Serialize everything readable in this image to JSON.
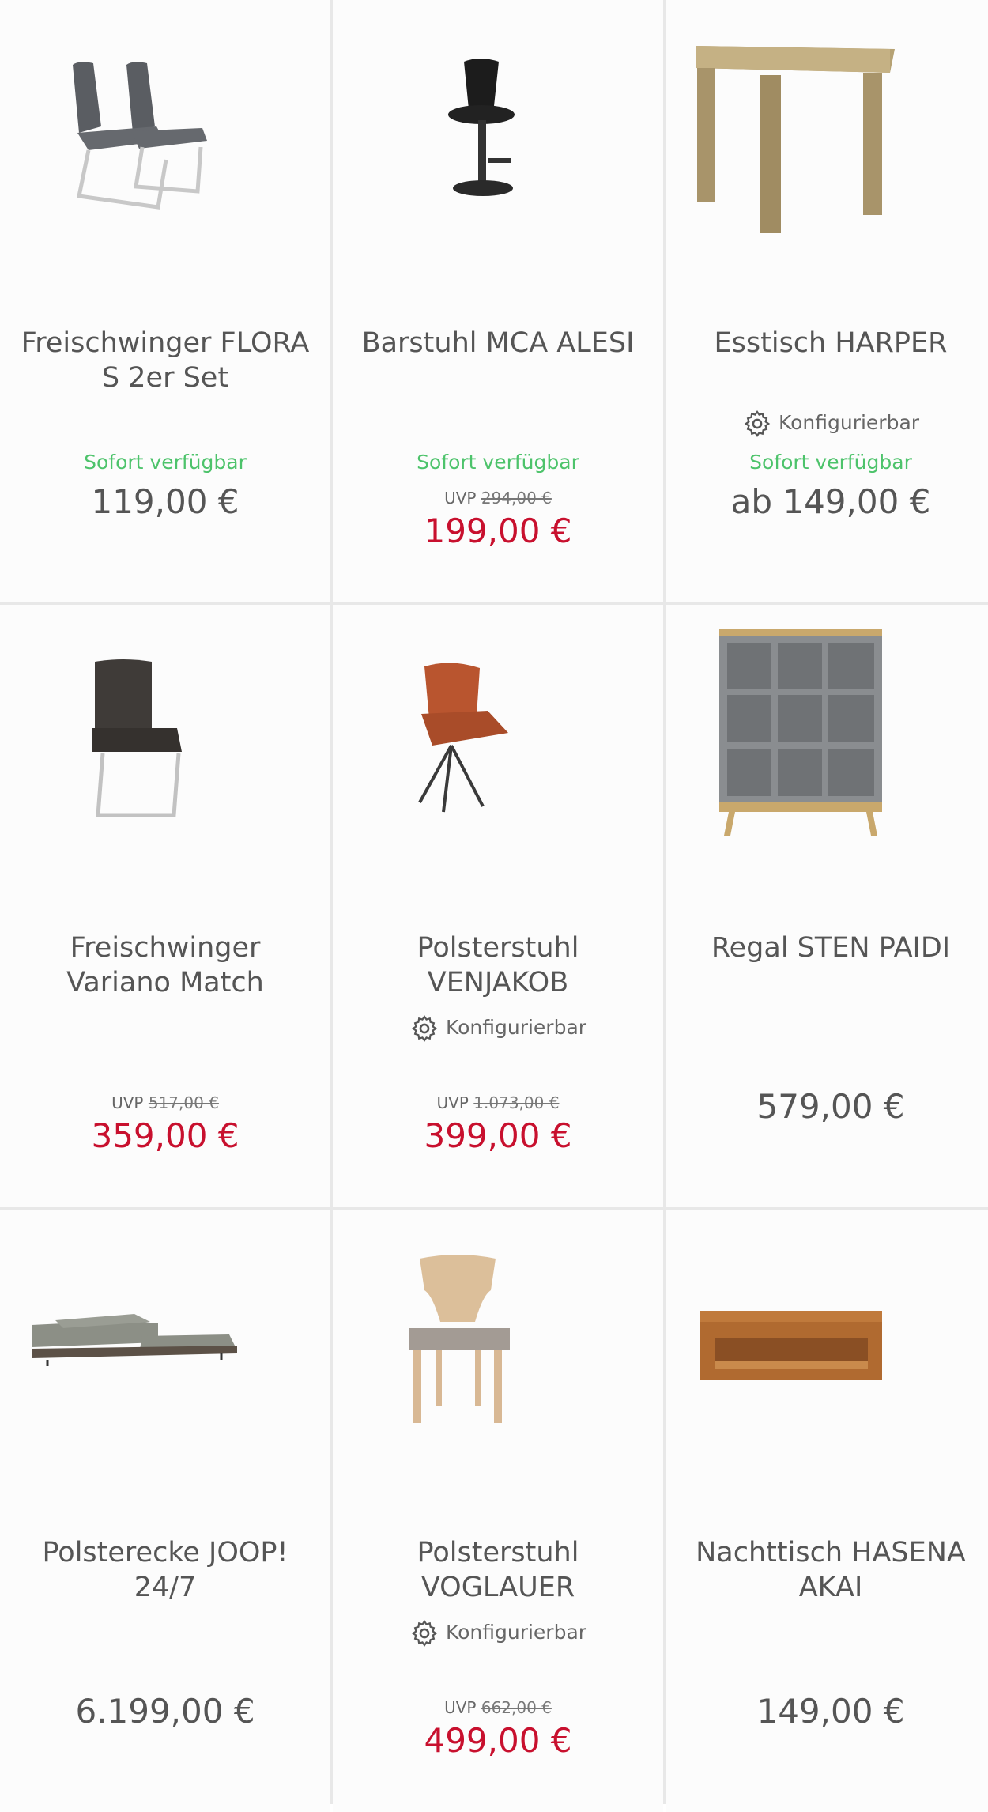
{
  "products": [
    {
      "title": "Freischwinger FLORA S 2er Set",
      "availability": "Sofort verfügbar",
      "price": "119,00 €",
      "icon": "chair-pair-image"
    },
    {
      "title": "Barstuhl MCA ALESI",
      "availability": "Sofort verfügbar",
      "uvp_label": "UVP",
      "uvp_price": "294,00 €",
      "price": "199,00 €",
      "icon": "bar-stool-image"
    },
    {
      "title": "Esstisch HARPER",
      "configurable": "Konfigurierbar",
      "availability": "Sofort verfügbar",
      "price": "ab 149,00 €",
      "icon": "table-image"
    },
    {
      "title": "Freischwinger Variano Match",
      "uvp_label": "UVP",
      "uvp_price": "517,00 €",
      "price": "359,00 €",
      "icon": "cantilever-chair-image"
    },
    {
      "title": "Polsterstuhl VENJAKOB",
      "configurable": "Konfigurierbar",
      "uvp_label": "UVP",
      "uvp_price": "1.073,00 €",
      "price": "399,00 €",
      "icon": "upholstered-chair-image"
    },
    {
      "title": "Regal STEN PAIDI",
      "price": "579,00 €",
      "icon": "shelf-image"
    },
    {
      "title": "Polsterecke JOOP! 24/7",
      "price": "6.199,00 €",
      "icon": "sofa-image"
    },
    {
      "title": "Polsterstuhl VOGLAUER",
      "configurable": "Konfigurierbar",
      "uvp_label": "UVP",
      "uvp_price": "662,00 €",
      "price": "499,00 €",
      "icon": "wooden-chair-image"
    },
    {
      "title": "Nachttisch HASENA AKAI",
      "price": "149,00 €",
      "icon": "nightstand-image"
    }
  ],
  "colors": {
    "sale": "#c8102e",
    "available": "#4dc36b",
    "text": "#555555"
  }
}
